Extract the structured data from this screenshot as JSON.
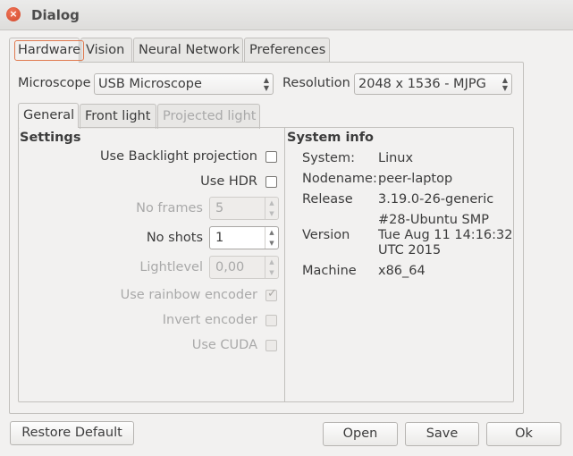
{
  "window": {
    "title": "Dialog",
    "close_glyph": "×"
  },
  "main_tabs": [
    {
      "label": "Hardware",
      "active": true
    },
    {
      "label": "Vision"
    },
    {
      "label": "Neural Network"
    },
    {
      "label": "Preferences"
    }
  ],
  "hardware": {
    "microscope_label": "Microscope",
    "microscope_value": "USB Microscope",
    "resolution_label": "Resolution",
    "resolution_value": "2048 x 1536 - MJPG"
  },
  "sub_tabs": [
    {
      "label": "General",
      "active": true
    },
    {
      "label": "Front light"
    },
    {
      "label": "Projected light",
      "disabled": true
    }
  ],
  "settings": {
    "heading": "Settings",
    "use_backlight_label": "Use Backlight projection",
    "use_backlight_checked": false,
    "use_hdr_label": "Use HDR",
    "use_hdr_checked": false,
    "no_frames_label": "No frames",
    "no_frames_value": "5",
    "no_shots_label": "No shots",
    "no_shots_value": "1",
    "lightlevel_label": "Lightlevel",
    "lightlevel_value": "0,00",
    "rainbow_label": "Use rainbow encoder",
    "rainbow_checked": true,
    "invert_label": "Invert encoder",
    "invert_checked": false,
    "cuda_label": "Use CUDA",
    "cuda_checked": false
  },
  "system_info": {
    "heading": "System info",
    "system_label": "System:",
    "system_value": "Linux",
    "nodename_label": "Nodename:",
    "nodename_value": "peer-laptop",
    "release_label": "Release",
    "release_value": "3.19.0-26-generic",
    "version_label": "Version",
    "version_line1": "#28-Ubuntu SMP",
    "version_line2": "Tue Aug 11 14:16:32",
    "version_line3": "UTC 2015",
    "machine_label": "Machine",
    "machine_value": "x86_64"
  },
  "buttons": {
    "restore": "Restore Default",
    "open": "Open",
    "save": "Save",
    "ok": "Ok"
  },
  "icons": {
    "combo_arrows": "▲▼",
    "spin_up": "▲",
    "spin_down": "▼",
    "check_mark": "✓"
  }
}
